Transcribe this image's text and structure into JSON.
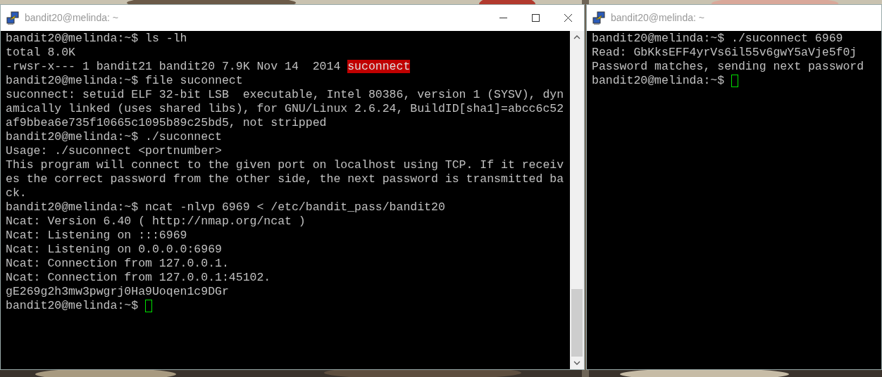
{
  "windows": [
    {
      "title": "bandit20@melinda: ~",
      "controls": true,
      "scrollbar": true,
      "lines": [
        {
          "text": "bandit20@melinda:~$ ls -lh"
        },
        {
          "text": "total 8.0K"
        },
        {
          "parts": [
            {
              "text": "-rwsr-x--- 1 bandit21 bandit20 7.9K Nov 14  2014 ",
              "highlighted": false
            },
            {
              "text": "suconnect",
              "highlighted": true
            }
          ]
        },
        {
          "text": "bandit20@melinda:~$ file suconnect"
        },
        {
          "text": "suconnect: setuid ELF 32-bit LSB  executable, Intel 80386, version 1 (SYSV), dyn"
        },
        {
          "text": "amically linked (uses shared libs), for GNU/Linux 2.6.24, BuildID[sha1]=abcc6c52"
        },
        {
          "text": "af9bbea6e735f10665c1095b89c25bd5, not stripped"
        },
        {
          "text": "bandit20@melinda:~$ ./suconnect"
        },
        {
          "text": "Usage: ./suconnect <portnumber>"
        },
        {
          "text": "This program will connect to the given port on localhost using TCP. If it receiv"
        },
        {
          "text": "es the correct password from the other side, the next password is transmitted ba"
        },
        {
          "text": "ck."
        },
        {
          "text": "bandit20@melinda:~$ ncat -nlvp 6969 < /etc/bandit_pass/bandit20"
        },
        {
          "text": "Ncat: Version 6.40 ( http://nmap.org/ncat )"
        },
        {
          "text": "Ncat: Listening on :::6969"
        },
        {
          "text": "Ncat: Listening on 0.0.0.0:6969"
        },
        {
          "text": "Ncat: Connection from 127.0.0.1."
        },
        {
          "text": "Ncat: Connection from 127.0.0.1:45102."
        },
        {
          "text": "gE269g2h3mw3pwgrj0Ha9Uoqen1c9DGr"
        },
        {
          "text": "bandit20@melinda:~$ ",
          "cursor": true
        }
      ]
    },
    {
      "title": "bandit20@melinda: ~",
      "controls": false,
      "scrollbar": false,
      "lines": [
        {
          "text": "bandit20@melinda:~$ ./suconnect 6969"
        },
        {
          "text": "Read: GbKksEFF4yrVs6il55v6gwY5aVje5f0j"
        },
        {
          "text": "Password matches, sending next password"
        },
        {
          "text": "bandit20@melinda:~$ ",
          "cursor": true
        }
      ]
    }
  ]
}
